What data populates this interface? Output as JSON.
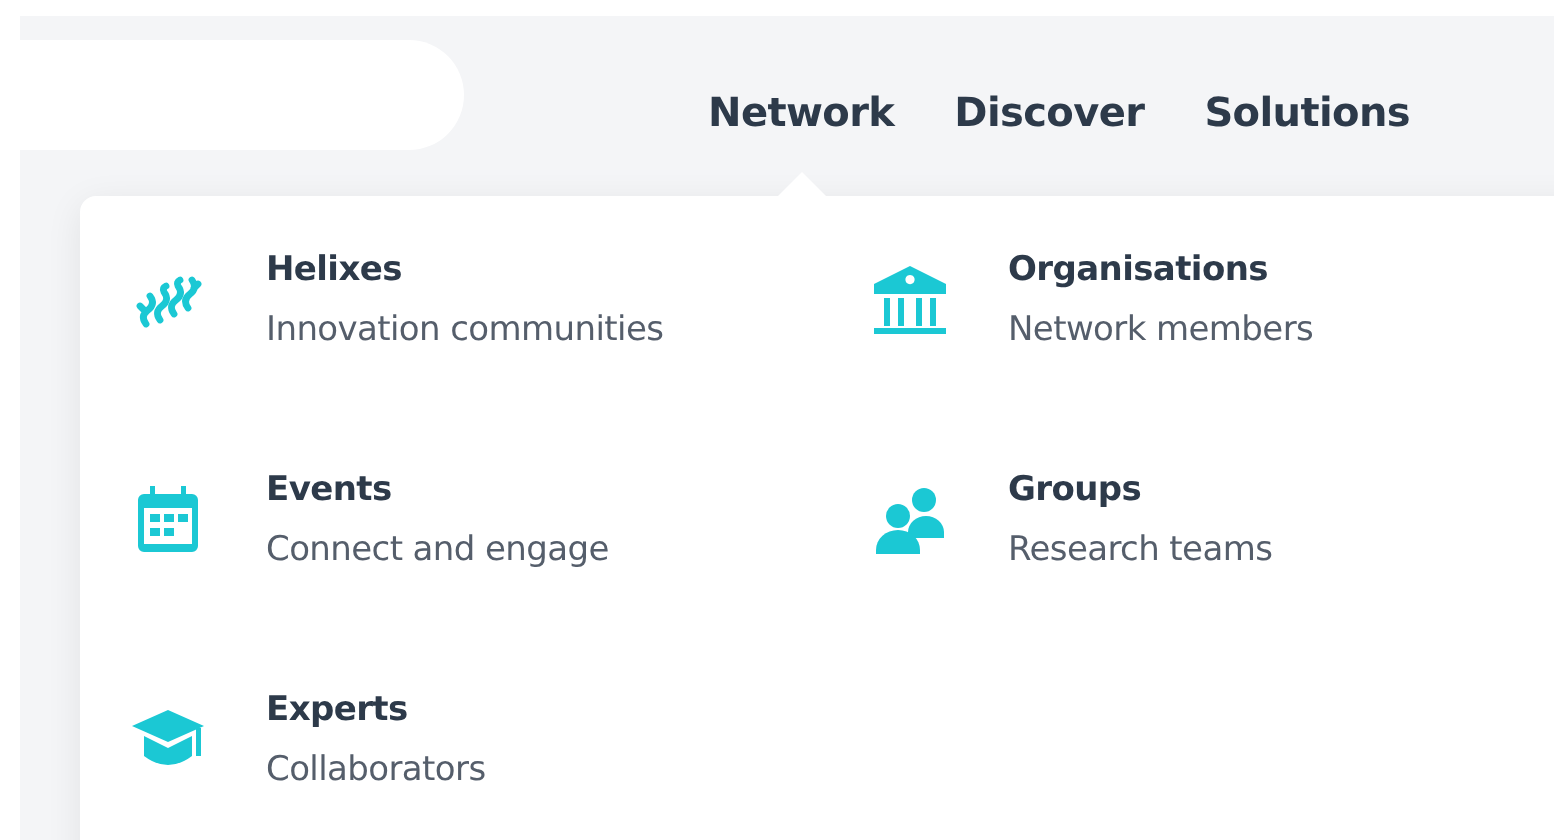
{
  "nav": [
    {
      "label": "Network",
      "selected": true
    },
    {
      "label": "Discover",
      "selected": false
    },
    {
      "label": "Solutions",
      "selected": false
    }
  ],
  "menu": {
    "items": [
      {
        "kind": "helix",
        "title": "Helixes",
        "subtitle": "Innovation communities"
      },
      {
        "kind": "building",
        "title": "Organisations",
        "subtitle": "Network members"
      },
      {
        "kind": "calendar",
        "title": "Events",
        "subtitle": "Connect and engage"
      },
      {
        "kind": "people",
        "title": "Groups",
        "subtitle": "Research teams"
      },
      {
        "kind": "cap",
        "title": "Experts",
        "subtitle": "Collaborators"
      }
    ]
  }
}
